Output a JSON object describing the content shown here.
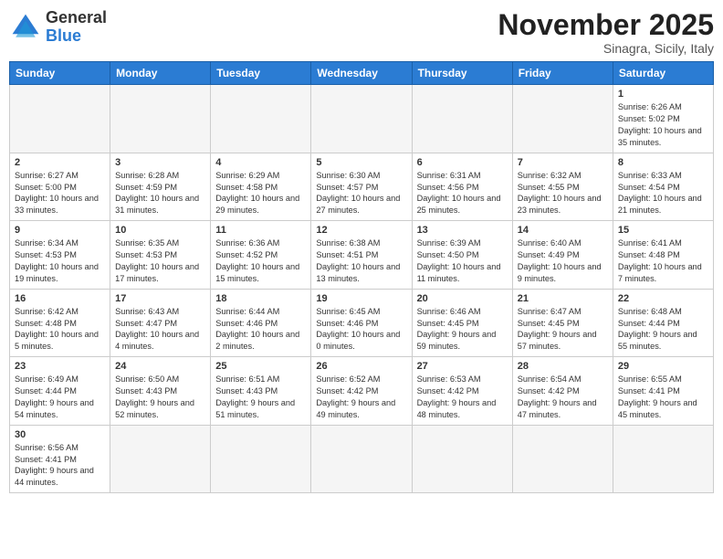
{
  "header": {
    "logo_general": "General",
    "logo_blue": "Blue",
    "month_title": "November 2025",
    "location": "Sinagra, Sicily, Italy"
  },
  "weekdays": [
    "Sunday",
    "Monday",
    "Tuesday",
    "Wednesday",
    "Thursday",
    "Friday",
    "Saturday"
  ],
  "weeks": [
    [
      {
        "day": "",
        "info": ""
      },
      {
        "day": "",
        "info": ""
      },
      {
        "day": "",
        "info": ""
      },
      {
        "day": "",
        "info": ""
      },
      {
        "day": "",
        "info": ""
      },
      {
        "day": "",
        "info": ""
      },
      {
        "day": "1",
        "info": "Sunrise: 6:26 AM\nSunset: 5:02 PM\nDaylight: 10 hours and 35 minutes."
      }
    ],
    [
      {
        "day": "2",
        "info": "Sunrise: 6:27 AM\nSunset: 5:00 PM\nDaylight: 10 hours and 33 minutes."
      },
      {
        "day": "3",
        "info": "Sunrise: 6:28 AM\nSunset: 4:59 PM\nDaylight: 10 hours and 31 minutes."
      },
      {
        "day": "4",
        "info": "Sunrise: 6:29 AM\nSunset: 4:58 PM\nDaylight: 10 hours and 29 minutes."
      },
      {
        "day": "5",
        "info": "Sunrise: 6:30 AM\nSunset: 4:57 PM\nDaylight: 10 hours and 27 minutes."
      },
      {
        "day": "6",
        "info": "Sunrise: 6:31 AM\nSunset: 4:56 PM\nDaylight: 10 hours and 25 minutes."
      },
      {
        "day": "7",
        "info": "Sunrise: 6:32 AM\nSunset: 4:55 PM\nDaylight: 10 hours and 23 minutes."
      },
      {
        "day": "8",
        "info": "Sunrise: 6:33 AM\nSunset: 4:54 PM\nDaylight: 10 hours and 21 minutes."
      }
    ],
    [
      {
        "day": "9",
        "info": "Sunrise: 6:34 AM\nSunset: 4:53 PM\nDaylight: 10 hours and 19 minutes."
      },
      {
        "day": "10",
        "info": "Sunrise: 6:35 AM\nSunset: 4:53 PM\nDaylight: 10 hours and 17 minutes."
      },
      {
        "day": "11",
        "info": "Sunrise: 6:36 AM\nSunset: 4:52 PM\nDaylight: 10 hours and 15 minutes."
      },
      {
        "day": "12",
        "info": "Sunrise: 6:38 AM\nSunset: 4:51 PM\nDaylight: 10 hours and 13 minutes."
      },
      {
        "day": "13",
        "info": "Sunrise: 6:39 AM\nSunset: 4:50 PM\nDaylight: 10 hours and 11 minutes."
      },
      {
        "day": "14",
        "info": "Sunrise: 6:40 AM\nSunset: 4:49 PM\nDaylight: 10 hours and 9 minutes."
      },
      {
        "day": "15",
        "info": "Sunrise: 6:41 AM\nSunset: 4:48 PM\nDaylight: 10 hours and 7 minutes."
      }
    ],
    [
      {
        "day": "16",
        "info": "Sunrise: 6:42 AM\nSunset: 4:48 PM\nDaylight: 10 hours and 5 minutes."
      },
      {
        "day": "17",
        "info": "Sunrise: 6:43 AM\nSunset: 4:47 PM\nDaylight: 10 hours and 4 minutes."
      },
      {
        "day": "18",
        "info": "Sunrise: 6:44 AM\nSunset: 4:46 PM\nDaylight: 10 hours and 2 minutes."
      },
      {
        "day": "19",
        "info": "Sunrise: 6:45 AM\nSunset: 4:46 PM\nDaylight: 10 hours and 0 minutes."
      },
      {
        "day": "20",
        "info": "Sunrise: 6:46 AM\nSunset: 4:45 PM\nDaylight: 9 hours and 59 minutes."
      },
      {
        "day": "21",
        "info": "Sunrise: 6:47 AM\nSunset: 4:45 PM\nDaylight: 9 hours and 57 minutes."
      },
      {
        "day": "22",
        "info": "Sunrise: 6:48 AM\nSunset: 4:44 PM\nDaylight: 9 hours and 55 minutes."
      }
    ],
    [
      {
        "day": "23",
        "info": "Sunrise: 6:49 AM\nSunset: 4:44 PM\nDaylight: 9 hours and 54 minutes."
      },
      {
        "day": "24",
        "info": "Sunrise: 6:50 AM\nSunset: 4:43 PM\nDaylight: 9 hours and 52 minutes."
      },
      {
        "day": "25",
        "info": "Sunrise: 6:51 AM\nSunset: 4:43 PM\nDaylight: 9 hours and 51 minutes."
      },
      {
        "day": "26",
        "info": "Sunrise: 6:52 AM\nSunset: 4:42 PM\nDaylight: 9 hours and 49 minutes."
      },
      {
        "day": "27",
        "info": "Sunrise: 6:53 AM\nSunset: 4:42 PM\nDaylight: 9 hours and 48 minutes."
      },
      {
        "day": "28",
        "info": "Sunrise: 6:54 AM\nSunset: 4:42 PM\nDaylight: 9 hours and 47 minutes."
      },
      {
        "day": "29",
        "info": "Sunrise: 6:55 AM\nSunset: 4:41 PM\nDaylight: 9 hours and 45 minutes."
      }
    ],
    [
      {
        "day": "30",
        "info": "Sunrise: 6:56 AM\nSunset: 4:41 PM\nDaylight: 9 hours and 44 minutes."
      },
      {
        "day": "",
        "info": ""
      },
      {
        "day": "",
        "info": ""
      },
      {
        "day": "",
        "info": ""
      },
      {
        "day": "",
        "info": ""
      },
      {
        "day": "",
        "info": ""
      },
      {
        "day": "",
        "info": ""
      }
    ]
  ]
}
